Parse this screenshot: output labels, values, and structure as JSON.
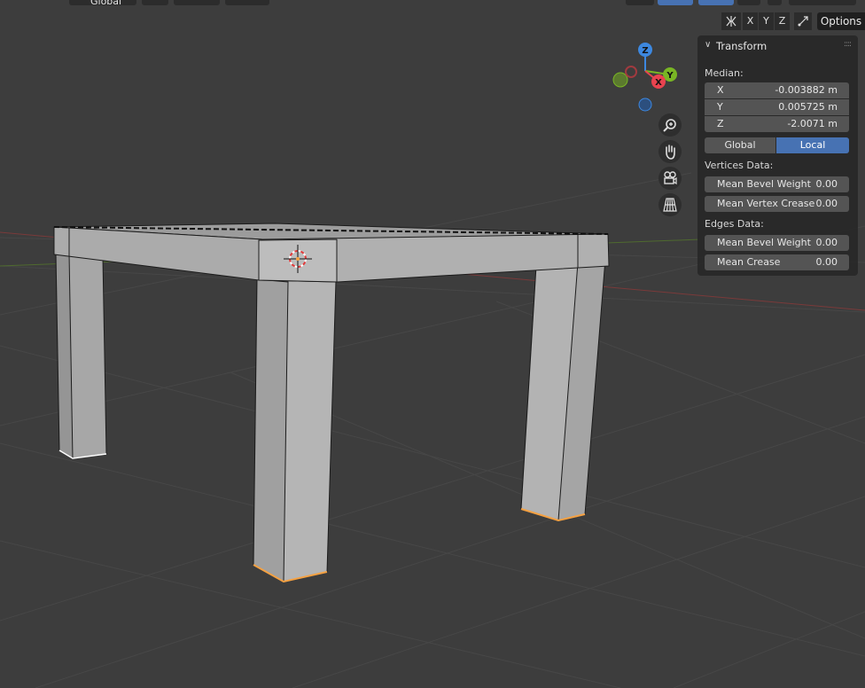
{
  "header": {
    "orientation_label": "Global",
    "axis_toggles": [
      "X",
      "Y",
      "Z"
    ],
    "options_label": "Options"
  },
  "gizmo": {
    "z_label": "Z",
    "y_label": "Y",
    "x_label": "X"
  },
  "transform_panel": {
    "title": "Transform",
    "median_label": "Median:",
    "x": {
      "label": "X",
      "value": "-0.003882 m"
    },
    "y": {
      "label": "Y",
      "value": "0.005725 m"
    },
    "z": {
      "label": "Z",
      "value": "-2.0071 m"
    },
    "space_global": "Global",
    "space_local": "Local",
    "vertices_section": "Vertices Data:",
    "v_bevel": {
      "label": "Mean Bevel Weight",
      "value": "0.00"
    },
    "v_crease": {
      "label": "Mean Vertex Crease",
      "value": "0.00"
    },
    "edges_section": "Edges Data:",
    "e_bevel": {
      "label": "Mean Bevel Weight",
      "value": "0.00"
    },
    "e_crease": {
      "label": "Mean Crease",
      "value": "0.00"
    }
  },
  "colors": {
    "background": "#3d3d3d",
    "accent": "#4772b3",
    "selection": "#f5a142",
    "axis_x": "#e8434f",
    "axis_y": "#79b624",
    "axis_z": "#3d88e0"
  }
}
